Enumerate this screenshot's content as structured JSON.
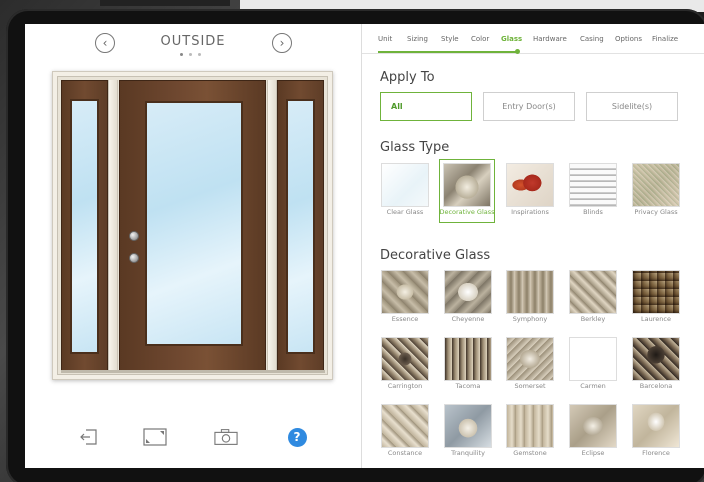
{
  "left": {
    "view_title": "OUTSIDE",
    "prev_glyph": "‹",
    "next_glyph": "›",
    "help_glyph": "?"
  },
  "tabs": [
    "Unit",
    "Sizing",
    "Style",
    "Color",
    "Glass",
    "Hardware",
    "Casing",
    "Options",
    "Finalize"
  ],
  "active_tab": "Glass",
  "apply_to": {
    "title": "Apply To",
    "options": [
      "All",
      "Entry Door(s)",
      "Sidelite(s)"
    ],
    "selected": "All"
  },
  "glass_type": {
    "title": "Glass Type",
    "items": [
      "Clear Glass",
      "Decorative Glass",
      "Inspirations",
      "Blinds",
      "Privacy Glass"
    ],
    "selected": "Decorative Glass"
  },
  "decorative_glass": {
    "title": "Decorative Glass",
    "items": [
      "Essence",
      "Cheyenne",
      "Symphony",
      "Berkley",
      "Laurence",
      "Carrington",
      "Tacoma",
      "Somerset",
      "Carmen",
      "Barcelona",
      "Constance",
      "Tranquility",
      "Gemstone",
      "Eclipse",
      "Florence"
    ]
  },
  "colors": {
    "accent": "#6fb33b",
    "help": "#2f8ae0",
    "door_wood": "#6f4830"
  },
  "icons": [
    "chevron-left-icon",
    "chevron-right-icon",
    "exit-icon",
    "fullscreen-icon",
    "camera-icon",
    "help-icon"
  ]
}
